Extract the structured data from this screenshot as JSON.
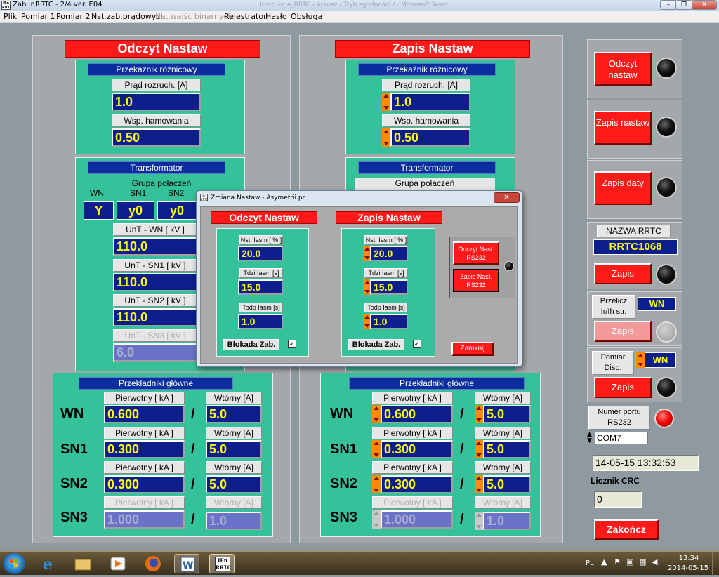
{
  "window": {
    "icon_text": "IEn RRTC",
    "title": "Zab. nRRTC - 2/4 ver. E04",
    "background_title": "Instrukcja_RRTC - Arkusz / Tryb zgodności / - Microsoft Word",
    "buttons": [
      "–",
      "❐",
      "✕"
    ]
  },
  "menu": [
    "Plik",
    "Pomiar 1",
    "Pomiar 2",
    "Nst.zab.prądowych",
    "Nst.wejść binarnych",
    "Rejestrator",
    "Hasło",
    "Obsługa"
  ],
  "read": {
    "header": "Odczyt Nastaw",
    "diff": {
      "title": "Przekaźnik różnicowy",
      "startup_label": "Prąd rozruch. [A]",
      "startup_value": "1.0",
      "brake_label": "Wsp. hamowania",
      "brake_value": "0.50"
    },
    "trafo": {
      "title": "Transformator",
      "group_label": "Grupa połaczeń",
      "group_cols": [
        "WN",
        "SN1",
        "SN2"
      ],
      "group_vals": [
        "Y",
        "y0",
        "y0"
      ],
      "rows": [
        {
          "label": "UnT - WN [ kV ]",
          "value": "110.0"
        },
        {
          "label": "UnT - SN1 [ kV ]",
          "value": "110.0"
        },
        {
          "label": "UnT - SN2 [ kV ]",
          "value": "110.0"
        },
        {
          "label": "UnT - SN3 [ kV ]",
          "value": "6.0"
        }
      ]
    },
    "ct": {
      "title": "Przekładniki główne",
      "rows": [
        {
          "name": "WN",
          "prim_label": "Pierwotny [ kA ]",
          "prim": "0.600",
          "sec_label": "Wtórny [A]",
          "sec": "5.0"
        },
        {
          "name": "SN1",
          "prim_label": "Pierwotny [ kA ]",
          "prim": "0.300",
          "sec_label": "Wtórny [A]",
          "sec": "5.0"
        },
        {
          "name": "SN2",
          "prim_label": "Pierwotny [ kA ]",
          "prim": "0.300",
          "sec_label": "Wtórny [A]",
          "sec": "5.0"
        },
        {
          "name": "SN3",
          "prim_label": "Pierwotny [ kA ]",
          "prim": "1.000",
          "sec_label": "Wtórny [A]",
          "sec": "1.0"
        }
      ]
    }
  },
  "write": {
    "header": "Zapis Nastaw",
    "diff": {
      "title": "Przekaźnik różnicowy",
      "startup_label": "Prąd rozruch. [A]",
      "startup_value": "1.0",
      "brake_label": "Wsp. hamowania",
      "brake_value": "0.50"
    },
    "trafo": {
      "title": "Transformator",
      "group_label": "Grupa połaczeń"
    },
    "ct": {
      "title": "Przekładniki główne",
      "rows": [
        {
          "name": "WN",
          "prim_label": "Pierwotny [ kA ]",
          "prim": "0.600",
          "sec_label": "Wtórny [A]",
          "sec": "5.0"
        },
        {
          "name": "SN1",
          "prim_label": "Pierwotny [ kA ]",
          "prim": "0.300",
          "sec_label": "Wtórny [A]",
          "sec": "5.0"
        },
        {
          "name": "SN2",
          "prim_label": "Pierwotny [ kA ]",
          "prim": "0.300",
          "sec_label": "Wtórny [A]",
          "sec": "5.0"
        },
        {
          "name": "SN3",
          "prim_label": "Pierwotny [ kA ]",
          "prim": "1.000",
          "sec_label": "Wtórny [A]",
          "sec": "1.0"
        }
      ]
    }
  },
  "side": {
    "read_btn": "Odczyt nastaw",
    "write_btn": "Zapis nastaw",
    "date_btn": "Zapis daty",
    "name_label": "NAZWA RRTC",
    "name_value": "RRTC1068",
    "name_save": "Zapis",
    "conv_label": "Przelicz Ir/Ih str.",
    "conv_value": "WN",
    "conv_save": "Zapis",
    "disp_label": "Pomiar Disp.",
    "disp_value": "WN",
    "disp_save": "Zapis",
    "port_label": "Numer portu RS232",
    "port_value": "COM7",
    "datetime": "14-05-15 13:32:53",
    "crc_label": "Licznik CRC",
    "crc_value": "0",
    "exit_btn": "Zakończ"
  },
  "dialog": {
    "title": "Zmiana Nastaw - Asymetrii pr.",
    "close": "✕",
    "read_header": "Odczyt Nastaw",
    "write_header": "Zapis Nastaw",
    "fields": [
      {
        "read_label": "Nst. Iasm [ % ]",
        "read_value": "20.0",
        "write_label": "Nst. Iasm [ % ]",
        "write_value": "20.0"
      },
      {
        "read_label": "Tdzi Iasm [s]",
        "read_value": "15.0",
        "write_label": "Tdzi Iasm [s]",
        "write_value": "15.0"
      },
      {
        "read_label": "Todp Iasm [s]",
        "read_value": "1.0",
        "write_label": "Todp Iasm [s]",
        "write_value": "1.0"
      }
    ],
    "block_label": "Blokada Zab.",
    "block_read_checked": true,
    "block_write_checked": true,
    "btn_read": "Odczyt Nast. RS232",
    "btn_write": "Zapis Nast. RS232",
    "btn_close": "Zamknij"
  },
  "taskbar": {
    "lang": "PL",
    "time": "13:34",
    "date": "2014-05-15",
    "app_label": "IEn RRTC"
  }
}
